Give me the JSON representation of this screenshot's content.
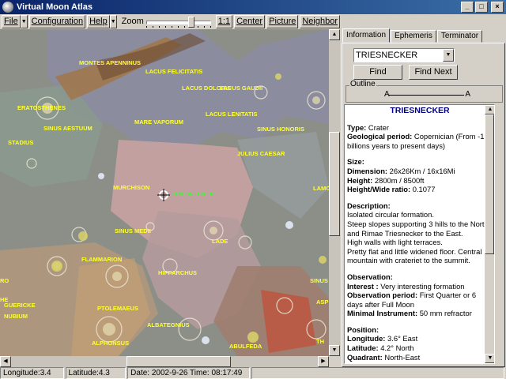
{
  "window": {
    "title": "Virtual Moon Atlas",
    "minimize": "_",
    "maximize": "□",
    "close": "×"
  },
  "toolbar": {
    "file": "File",
    "configuration": "Configuration",
    "help": "Help",
    "zoom_label": "Zoom",
    "one_to_one": "1:1",
    "center": "Center",
    "picture": "Picture",
    "neighbor": "Neighbor",
    "arrow": "▼"
  },
  "map": {
    "labels": [
      "MONTES APENNINUS",
      "LACUS FELICITATIS",
      "LACUS DOLORIS",
      "LACUS GAUDII",
      "ERATOSTHENES",
      "SINUS AESTUUM",
      "MARE VAPORUM",
      "LACUS LENITATIS",
      "SINUS HONORIS",
      "STADIUS",
      "JULIUS CAESAR",
      "MURCHISON",
      "TRIESNECKER",
      "SINUS MEDII",
      "LADE",
      "LAMONT",
      "FLAMMARION",
      "HIPPARCHUS",
      "SINUS ASPERITATIS",
      "NUBIUM",
      "PTOLEMAEUS",
      "ALBATEGNIUS",
      "GUERICKE",
      "ALPHONSUS",
      "ABULFEDA",
      "RO",
      "HE",
      "ASP",
      "TH"
    ]
  },
  "tabs": [
    "Information",
    "Ephemeris",
    "Terminator"
  ],
  "panel": {
    "search_value": "TRIESNECKER",
    "find": "Find",
    "find_next": "Find Next",
    "outline_label": "Outline",
    "point_a": "A",
    "point_b": "A"
  },
  "info": {
    "name": "TRIESNECKER",
    "type_label": "Type:",
    "type_value": "Crater",
    "geo_label": "Geological period:",
    "geo_value": "Copernician (From -1.1 billions years to present days)",
    "size_header": "Size:",
    "dim_label": "Dimension:",
    "dim_value": "26x26Km / 16x16Mi",
    "height_label": "Height:",
    "height_value": "2800m / 8500ft",
    "ratio_label": "Height/Wide ratio:",
    "ratio_value": "0.1077",
    "desc_header": "Description:",
    "desc_lines": [
      "Isolated circular formation.",
      "Steep slopes supporting 3 hills to the North and Rimae Triesnecker to the East.",
      "High walls with light terraces.",
      "Pretty flat and little widened floor. Central mountain with crateriet to the summit."
    ],
    "obs_header": "Observation:",
    "interest_label": "Interest :",
    "interest_value": "Very interesting formation",
    "period_label": "Observation period:",
    "period_value": "First Quarter or 6 days after Full Moon",
    "instr_label": "Minimal Instrument:",
    "instr_value": "50 mm refractor",
    "pos_header": "Position:",
    "lon_label": "Longitude:",
    "lon_value": "3.6° East",
    "lat_label": "Latitude:",
    "lat_value": "4.2° North",
    "quad_label": "Quadrant:",
    "quad_value": "North-East"
  },
  "status": {
    "longitude": "Longitude:3.4",
    "latitude": "Latitude:4.3",
    "datetime": "Date: 2002-9-26   Time: 08:17:49"
  },
  "zoom_level": 0.52,
  "colors": {
    "label": "#ffff33",
    "selected_label": "#33ff33",
    "title": "#00008b"
  }
}
